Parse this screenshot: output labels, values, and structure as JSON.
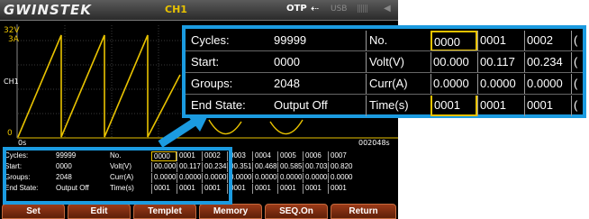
{
  "header": {
    "logo": "GWINSTEK",
    "channel": "CH1",
    "otp": "OTP",
    "usb_arrow": "⇠",
    "usb": "USB",
    "lan": "||||||",
    "speaker": "◀"
  },
  "waveform": {
    "voltage_max": "32V",
    "current_max": "3A",
    "channel_tag": "CH1",
    "zero": "0",
    "time_start": "0s",
    "time_end": "002048s",
    "trace_color": "#e8c200"
  },
  "table": {
    "params": [
      {
        "label": "Cycles:",
        "value": "99999"
      },
      {
        "label": "Start:",
        "value": "0000"
      },
      {
        "label": "Groups:",
        "value": "2048"
      },
      {
        "label": "End State:",
        "value": "Output Off"
      }
    ],
    "headers": [
      "No.",
      "Volt(V)",
      "Curr(A)",
      "Time(s)"
    ],
    "columns": [
      {
        "no": "0000",
        "volt": "00.000",
        "curr": "0.0000",
        "time": "0001"
      },
      {
        "no": "0001",
        "volt": "00.117",
        "curr": "0.0000",
        "time": "0001"
      },
      {
        "no": "0002",
        "volt": "00.234",
        "curr": "0.0000",
        "time": "0001"
      },
      {
        "no": "0003",
        "volt": "00.351",
        "curr": "0.0000",
        "time": "0001"
      },
      {
        "no": "0004",
        "volt": "00.468",
        "curr": "0.0000",
        "time": "0001"
      },
      {
        "no": "0005",
        "volt": "00.585",
        "curr": "0.0000",
        "time": "0001"
      },
      {
        "no": "0006",
        "volt": "00.703",
        "curr": "0.0000",
        "time": "0001"
      },
      {
        "no": "0007",
        "volt": "00.820",
        "curr": "0.0000",
        "time": "0001"
      }
    ],
    "zoom_columns": [
      {
        "no": "0000",
        "volt": "00.000",
        "curr": "0.0000",
        "time": "0001"
      },
      {
        "no": "0001",
        "volt": "00.117",
        "curr": "0.0000",
        "time": "0001"
      },
      {
        "no": "0002",
        "volt": "00.234",
        "curr": "0.0000",
        "time": "0001"
      },
      {
        "no": "(",
        "volt": "(",
        "curr": "(",
        "time": "("
      }
    ],
    "selection_color": "#e8c200"
  },
  "softkeys": [
    "Set",
    "Edit",
    "Templet",
    "Memory",
    "SEQ.On",
    "Return"
  ],
  "colors": {
    "callout": "#1b9be0",
    "softkey": "#7a2a10",
    "channel": "#e8c200"
  }
}
